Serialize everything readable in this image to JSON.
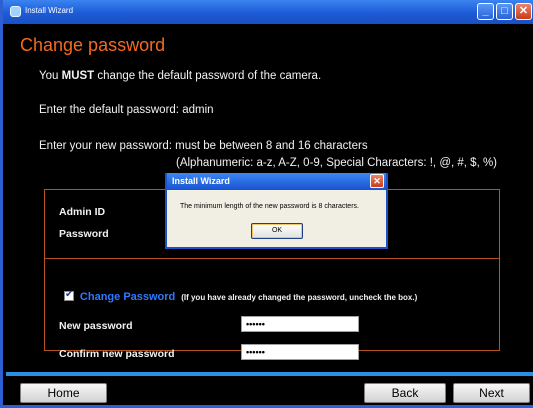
{
  "window": {
    "title": "Install Wizard"
  },
  "page": {
    "heading": "Change password",
    "must_prefix": "You ",
    "must_word": "MUST",
    "must_suffix": " change the default password of the camera.",
    "default_password_line": "Enter the default password: admin",
    "new_password_line": "Enter your new password: must be between 8 and 16 characters",
    "charset_note": "(Alphanumeric: a-z, A-Z, 0-9, Special Characters: !, @, #, $, %)"
  },
  "form": {
    "admin_id_label": "Admin ID",
    "password_label": "Password",
    "change_password_checked": true,
    "change_password_label": "Change Password",
    "change_password_note": "(If you have already changed the password, uncheck the box.)",
    "new_password_label": "New password",
    "new_password_value": "••••••",
    "confirm_password_label": "Confirm new password",
    "confirm_password_value": "••••••"
  },
  "footer": {
    "home_label": "Home",
    "back_label": "Back",
    "next_label": "Next"
  },
  "dialog": {
    "title": "Install Wizard",
    "message": "The minimum length of the new password is 8 characters.",
    "ok_label": "OK"
  },
  "colors": {
    "accent": "#f46a1f",
    "titlebar": "#1d5bd6",
    "link": "#2f78ff",
    "frame": "#b5541f"
  }
}
